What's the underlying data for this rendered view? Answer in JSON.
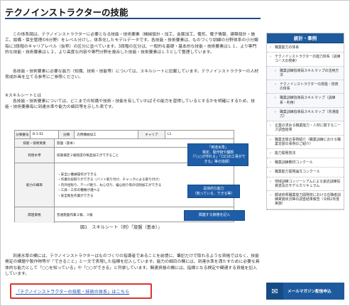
{
  "page": {
    "title": "テクノインストラクターの技能"
  },
  "content": {
    "p1": "この体系図は、テクノインストラクターに必要となる技能・技術要素（機械設計・加工、金属加工、電気、電子情報、建築設計・施工、設備・保全管理の6分野）をレベル分けし、体系化したモデルデータです。各技能・技術要素は、ものづくり訓練の分野体系の小分類毎に3段階のキャリアレベル（仮称）の区分に並べています。3段階の区分は、一般的な基礎・基本的な技能・技術要素はＬ１、より専門的な技能・技術要素はＬ２、より高度な内容や専門分野を複合した技能・技術要素はＬ３として整理しています。",
    "p2": "各技能・技術要素に必要な能力（知識、技術・技能等）については、スキルシートに記載しています。テクノインストラクターの人材育成計画を立てる参考にご参照ください。",
    "p3": "※スキルシートとは",
    "p4": "各技能・技術要素については、どこまでの知識や技術・技能を有していればその能力を習得しているとするかを明確にするため、技能・技術要素毎に到達水準や能力の細目等を示した表です。",
    "p5": "到達水準の欄には、テクノインストラクターはものづくりの指導者であることを前提に、筆記だけで取れるような資格ではなく、技能検定の課題や製作物等が「できること」と一文で表現した指標を記入しています。能力の細目の欄には、到達水準を満たすために必要な具体的な能力として「○○を知っている」や「○○ができる」と列挙しています。関連資格の欄には、指標となる検定や関連する資格を記入しています。",
    "link": "「テクノインストラクターの技能・技術の体系」はこちら"
  },
  "figure": {
    "header": {
      "no_label": "分類番号",
      "no_value": "B-1-01",
      "cat_label": "分類",
      "cat_value": "汎用機械加工",
      "career_label": "キャリア",
      "career_value": "L1"
    },
    "skill_label": "技能・技術要素",
    "skill_value": "旋盤（基本）",
    "level_label": "到達水準",
    "level_value": "技能検定２級程度の製品加工ができること",
    "detail_label": "能力の細目",
    "details": [
      "・安全に機械操作ができる",
      "・作業の段取りができる（バイト取り付け、チャックによる取り付け）",
      "・内外径削り、テーパ削り、ねじ切り、偏心削り等の切削加工ができる",
      "・工具・工作の種類が選べる",
      "・安全衛生作業ができる"
    ],
    "cert_label": "関連資格",
    "cert_value": "普通旋盤作業２級、３級",
    "callout1": "「到達水準」\n検定、製作物や課題\n（「○○が作れる」「口口の工事ができる」等の指標）",
    "callout2": "具体的な能力\n（知っている、できる等）",
    "callout3": "関連する資格を記入",
    "caption": "図1　スキルシート（例）「旋盤（基本）」"
  },
  "sidebar": {
    "head": "統計・事例",
    "items": [
      {
        "label": "職業能力の体系",
        "sub": false
      },
      {
        "label": "テクノインストラクターの能力体系（訓練コースの検索）",
        "sub": false
      },
      {
        "label": "職業訓練指導員スキルマップの活用方法",
        "sub": true
      },
      {
        "label": "テクノインストラクターの技能・技術の体系",
        "sub": true
      },
      {
        "label": "職業訓練指導員スキルマップ（訓練系・利用）",
        "sub": true
      },
      {
        "label": "職業訓練指導員スキルマップ（共通能力）",
        "sub": true
      },
      {
        "label": "企業の求める職業能力・人材に関するニーズ調査結果",
        "sub": false
      },
      {
        "label": "職業支援の事例紹介（職業訓練における職業支援の事例のご紹介）",
        "sub": false
      },
      {
        "label": "能力開発技法",
        "sub": false
      },
      {
        "label": "職業訓練教材コンクール",
        "sub": false
      },
      {
        "label": "職業能力開発論文コンクール",
        "sub": false
      },
      {
        "label": "地域訓練コンソーシアムによる委託訓練投資波及のモデルカリキュラム",
        "sub": false
      },
      {
        "label": "都道府県職業能力開発校における在職者訓練実施状況等の調査結果報告（令和2年度実施）",
        "sub": false
      }
    ],
    "mail_label": "メールマガジン配信申込",
    "mail_icon": "mail-icon"
  }
}
